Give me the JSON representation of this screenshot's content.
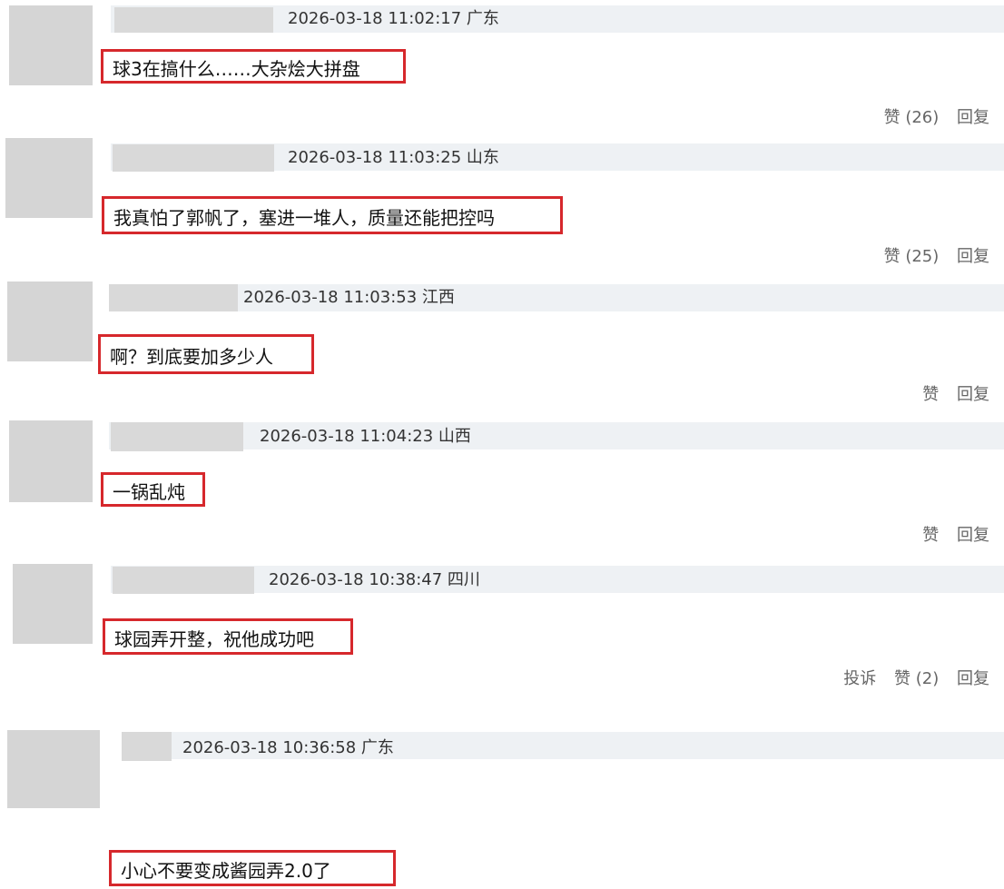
{
  "comments": [
    {
      "timestamp": "2026-03-18 11:02:17",
      "location": "广东",
      "text": "球3在搞什么……大杂烩大拼盘",
      "like_label": "赞",
      "like_count": "(26)",
      "reply_label": "回复"
    },
    {
      "timestamp": "2026-03-18 11:03:25",
      "location": "山东",
      "text": "我真怕了郭帆了，塞进一堆人，质量还能把控吗",
      "like_label": "赞",
      "like_count": "(25)",
      "reply_label": "回复"
    },
    {
      "timestamp": "2026-03-18 11:03:53",
      "location": "江西",
      "text": "啊？到底要加多少人",
      "like_label": "赞",
      "like_count": "",
      "reply_label": "回复"
    },
    {
      "timestamp": "2026-03-18 11:04:23",
      "location": "山西",
      "text": "一锅乱炖",
      "like_label": "赞",
      "like_count": "",
      "reply_label": "回复"
    },
    {
      "timestamp": "2026-03-18 10:38:47",
      "location": "四川",
      "text": "球园弄开整，祝他成功吧",
      "report_label": "投诉",
      "like_label": "赞",
      "like_count": "(2)",
      "reply_label": "回复"
    },
    {
      "timestamp": "2026-03-18 10:36:58",
      "location": "广东",
      "text": "小心不要变成酱园弄2.0了"
    }
  ]
}
